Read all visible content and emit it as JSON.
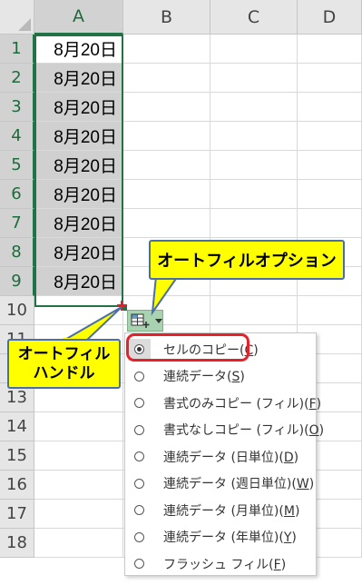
{
  "columns": [
    "A",
    "B",
    "C",
    "D"
  ],
  "selected_column": "A",
  "rows": [
    "1",
    "2",
    "3",
    "4",
    "5",
    "6",
    "7",
    "8",
    "9",
    "10",
    "11",
    "12",
    "13",
    "14",
    "15",
    "16",
    "17",
    "18"
  ],
  "cells_A": [
    "8月20日",
    "8月20日",
    "8月20日",
    "8月20日",
    "8月20日",
    "8月20日",
    "8月20日",
    "8月20日",
    "8月20日"
  ],
  "callouts": {
    "autofill_options": "オートフィルオプション",
    "autofill_handle_line1": "オートフィル",
    "autofill_handle_line2": "ハンドル"
  },
  "menu": {
    "items": [
      {
        "label": "セルのコピー",
        "key": "C",
        "selected": true
      },
      {
        "label": "連続データ",
        "key": "S",
        "selected": false
      },
      {
        "label": "書式のみコピー (フィル)",
        "key": "F",
        "selected": false
      },
      {
        "label": "書式なしコピー (フィル)",
        "key": "O",
        "selected": false
      },
      {
        "label": "連続データ (日単位)",
        "key": "D",
        "selected": false
      },
      {
        "label": "連続データ (週日単位)",
        "key": "W",
        "selected": false
      },
      {
        "label": "連続データ (月単位)",
        "key": "M",
        "selected": false
      },
      {
        "label": "連続データ (年単位)",
        "key": "Y",
        "selected": false
      },
      {
        "label": "フラッシュ フィル",
        "key": "F",
        "selected": false
      }
    ]
  },
  "colors": {
    "selection": "#217346",
    "callout_fill": "#ffff00",
    "highlight": "#e8202a"
  }
}
